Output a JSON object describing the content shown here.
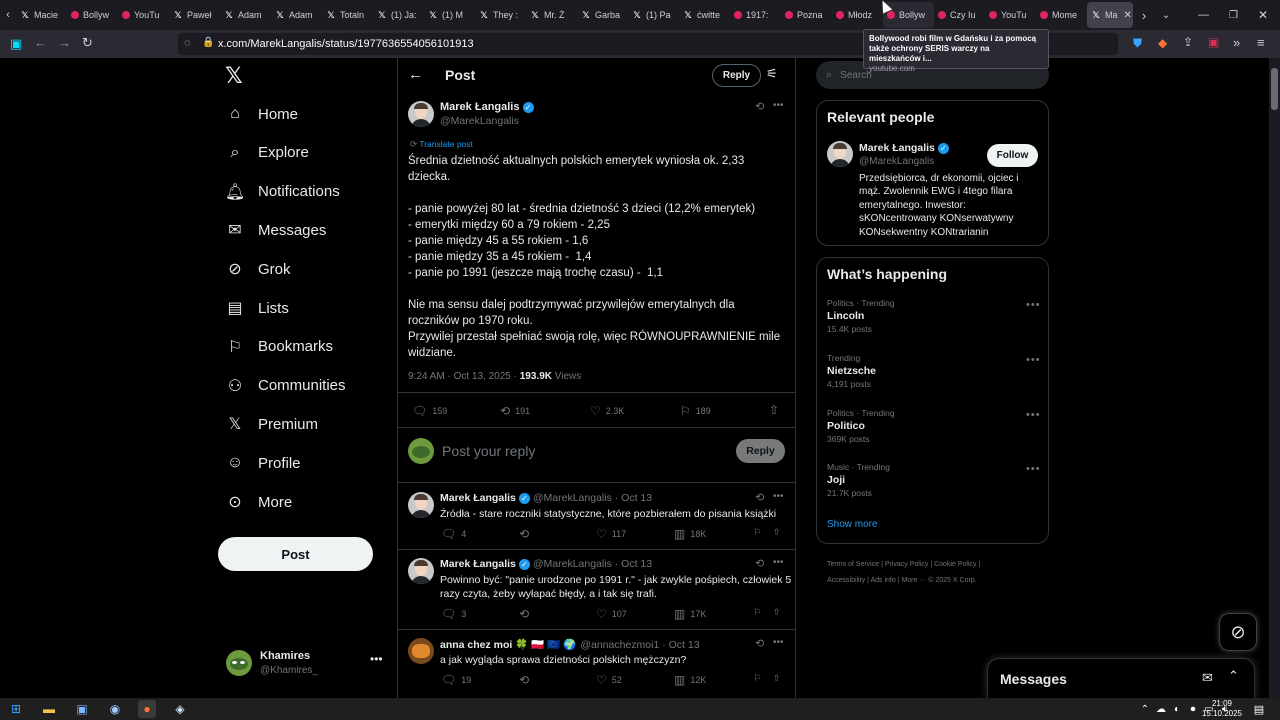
{
  "browser": {
    "tabs": [
      {
        "label": "Macie",
        "icon": "x"
      },
      {
        "label": "Bollyw",
        "icon": "youtube"
      },
      {
        "label": "YouTu",
        "icon": "youtube"
      },
      {
        "label": "Paweł",
        "icon": "x"
      },
      {
        "label": "Adam",
        "icon": "x"
      },
      {
        "label": "Adam",
        "icon": "x"
      },
      {
        "label": "Totaln",
        "icon": "x"
      },
      {
        "label": "(1) Ja:",
        "icon": "x"
      },
      {
        "label": "(1) M",
        "icon": "x"
      },
      {
        "label": "They :",
        "icon": "x"
      },
      {
        "label": "Mr. Ż",
        "icon": "x"
      },
      {
        "label": "Garba",
        "icon": "x"
      },
      {
        "label": "(1) Pa",
        "icon": "x"
      },
      {
        "label": "ćwitte",
        "icon": "x"
      },
      {
        "label": "1917:",
        "icon": "youtube"
      },
      {
        "label": "Pozna",
        "icon": "youtube"
      },
      {
        "label": "Młodz",
        "icon": "youtube"
      },
      {
        "label": "Bollyw",
        "icon": "youtube"
      },
      {
        "label": "Czy Iu",
        "icon": "youtube"
      },
      {
        "label": "YouTu",
        "icon": "youtube"
      },
      {
        "label": "Mome",
        "icon": "youtube"
      },
      {
        "label": "Ma",
        "icon": "x"
      }
    ],
    "url": "x.com/MarekLangalis/status/1977636554056101913",
    "tooltip": {
      "title": "Bollywood robi film w Gdańsku i za pomocą także ochrony SERIS warczy na mieszkańców i...",
      "source": "youtube.com"
    }
  },
  "nav": {
    "items": [
      {
        "label": "Home",
        "icon": "home-icon"
      },
      {
        "label": "Explore",
        "icon": "search-icon"
      },
      {
        "label": "Notifications",
        "icon": "bell-icon"
      },
      {
        "label": "Messages",
        "icon": "mail-icon"
      },
      {
        "label": "Grok",
        "icon": "grok-icon"
      },
      {
        "label": "Lists",
        "icon": "list-icon"
      },
      {
        "label": "Bookmarks",
        "icon": "bookmark-icon"
      },
      {
        "label": "Communities",
        "icon": "people-icon"
      },
      {
        "label": "Premium",
        "icon": "x-icon"
      },
      {
        "label": "Profile",
        "icon": "person-icon"
      },
      {
        "label": "More",
        "icon": "more-circle-icon"
      }
    ],
    "post_label": "Post",
    "account": {
      "name": "Khamires",
      "handle": "@Khamires_"
    }
  },
  "header": {
    "title": "Post",
    "reply_label": "Reply"
  },
  "main_post": {
    "author": "Marek Łangalis",
    "handle": "@MarekLangalis",
    "translate": "Translate post",
    "lines": [
      "Średnia dzietność aktualnych polskich emerytek wyniosła ok. 2,33",
      "dziecka.",
      "",
      "- panie powyżej 80 lat - średnia dzietność 3 dzieci (12,2% emerytek)",
      "- emerytki między 60 a 79 rokiem - 2,25",
      "- panie między 45 a 55 rokiem - 1,6",
      "- panie między 35 a 45 rokiem -  1,4",
      "- panie po 1991 (jeszcze mają trochę czasu) -  1,1",
      "",
      "Nie ma sensu dalej podtrzymywać przywilejów emerytalnych dla",
      "roczników po 1970 roku.",
      "Przywilej przestał spełniać swoją rolę, więc RÓWNOUPRAWNIENIE mile",
      "widziane."
    ],
    "timestamp": "9:24 AM · Oct 13, 2025 · ",
    "views": "193.9K",
    "views_label": " Views",
    "replies": "159",
    "reposts": "191",
    "likes": "2.3K",
    "bookmarks": "189"
  },
  "composer": {
    "placeholder": "Post your reply",
    "button": "Reply"
  },
  "replies": [
    {
      "author": "Marek Łangalis",
      "meta": "@MarekLangalis · Oct 13",
      "text": [
        "Źródła - stare roczniki statystyczne, które pozbierałem do pisania książki"
      ],
      "replies": "4",
      "reposts": "",
      "likes": "117",
      "views": "18K"
    },
    {
      "author": "Marek Łangalis",
      "meta": "@MarekLangalis · Oct 13",
      "text": [
        "Powinno być: \"panie urodzone po 1991 r.\" - jak zwykle pośpiech, człowiek 5",
        "razy czyta, żeby wyłapać błędy, a i tak się trafi."
      ],
      "replies": "3",
      "reposts": "",
      "likes": "107",
      "views": "17K"
    },
    {
      "author": "anna chez moi 🍀 🇵🇱 🇪🇺 🌍",
      "meta": "@annachezmoi1 · Oct 13",
      "text": [
        "a jak wygląda sprawa dzietności polskich mężczyzn?"
      ],
      "replies": "19",
      "reposts": "",
      "likes": "52",
      "views": "12K"
    }
  ],
  "search": {
    "placeholder": "Search"
  },
  "relevant": {
    "title": "Relevant people",
    "name": "Marek Łangalis",
    "handle": "@MarekLangalis",
    "follow": "Follow",
    "bio": [
      "Przedsiębiorca, dr ekonomii, ojciec i",
      "mąż. Zwolennik EWG i 4tego filara",
      "emerytalnego. Inwestor:",
      "sKONcentrowany KONserwatywny",
      "KONsekwentny KONtrarianin"
    ]
  },
  "happening": {
    "title": "What’s happening",
    "trends": [
      {
        "category": "Politics · Trending",
        "name": "Lincoln",
        "count": "15.4K posts"
      },
      {
        "category": "Trending",
        "name": "Nietzsche",
        "count": "4,191 posts"
      },
      {
        "category": "Politics · Trending",
        "name": "Politico",
        "count": "369K posts"
      },
      {
        "category": "Music · Trending",
        "name": "Joji",
        "count": "21.7K posts"
      }
    ],
    "show_more": "Show more"
  },
  "footer": {
    "line1": "Terms of Service  |  Privacy Policy  |  Cookie Policy  |",
    "line2": "Accessibility  |  Ads info  |  More ···  © 2025 X Corp."
  },
  "messages": {
    "title": "Messages"
  },
  "taskbar": {
    "time": "21:09",
    "date": "15.10.2025"
  },
  "colors": {
    "accent": "#1d9bf0",
    "bg": "#000000",
    "border": "#2f3336",
    "muted": "#71767b"
  }
}
